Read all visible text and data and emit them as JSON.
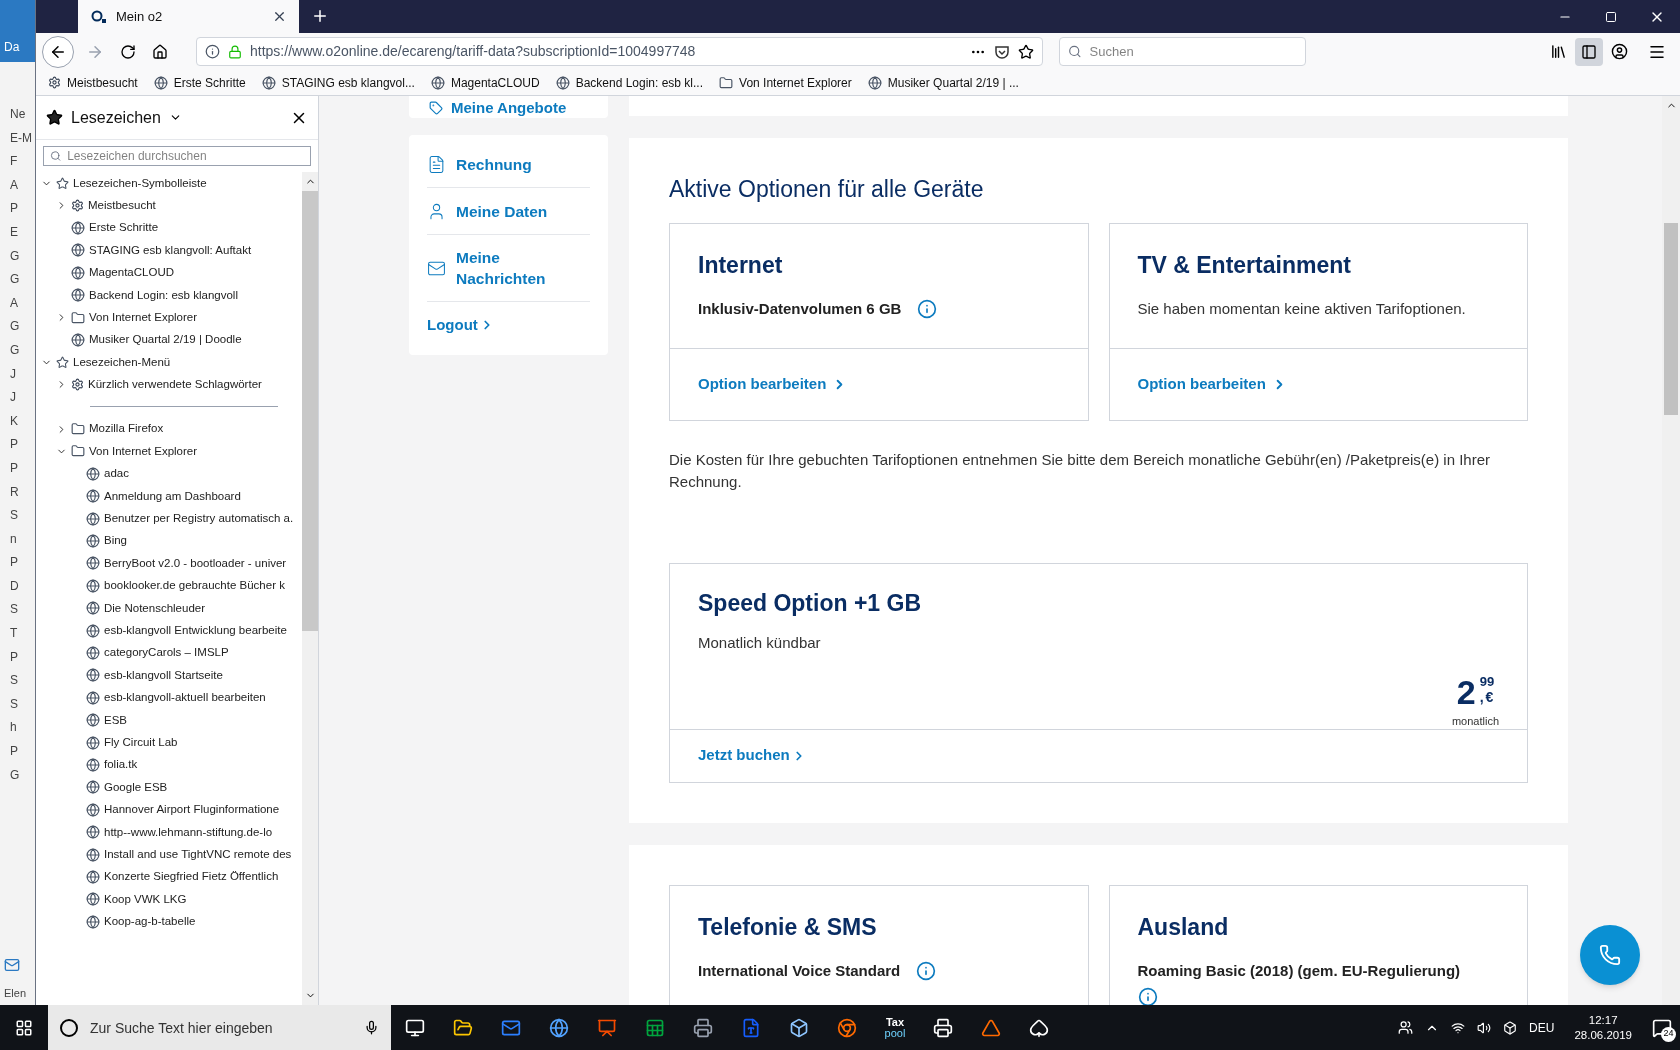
{
  "background_window": {
    "title": "Da",
    "letters": [
      "Ne",
      "E-M",
      "F",
      "A",
      "P",
      "E",
      "G",
      "G",
      "A",
      "G",
      "G",
      "J",
      "J",
      "K",
      "P",
      "P",
      "R",
      "S",
      "n",
      "P",
      "D",
      "S",
      "T",
      "P",
      "S",
      "S",
      "h",
      "P",
      "G"
    ],
    "footer": "Elen"
  },
  "browser": {
    "tab_title": "Mein o2",
    "url": "https://www.o2online.de/ecareng/tariff-data?subscriptionId=1004997748",
    "search_placeholder": "Suchen",
    "bookmarks_toolbar": [
      {
        "label": "Meistbesucht",
        "kind": "query"
      },
      {
        "label": "Erste Schritte",
        "kind": "bookmark"
      },
      {
        "label": "STAGING esb klangvol...",
        "kind": "bookmark"
      },
      {
        "label": "MagentaCLOUD",
        "kind": "bookmark"
      },
      {
        "label": "Backend Login: esb kl...",
        "kind": "bookmark"
      },
      {
        "label": "Von Internet Explorer",
        "kind": "folder"
      },
      {
        "label": "Musiker Quartal 2/19 | ...",
        "kind": "bookmark"
      }
    ]
  },
  "sidebar": {
    "title": "Lesezeichen",
    "search_placeholder": "Lesezeichen durchsuchen",
    "tree": [
      {
        "label": "Lesezeichen-Symbolleiste",
        "kind": "root",
        "expanded": true,
        "children": [
          {
            "label": "Meistbesucht",
            "kind": "query",
            "expanded": false
          },
          {
            "label": "Erste Schritte",
            "kind": "bookmark"
          },
          {
            "label": "STAGING esb klangvoll: Auftakt",
            "kind": "bookmark"
          },
          {
            "label": "MagentaCLOUD",
            "kind": "bookmark"
          },
          {
            "label": "Backend Login: esb klangvoll",
            "kind": "bookmark"
          },
          {
            "label": "Von Internet Explorer",
            "kind": "folder",
            "expanded": false
          },
          {
            "label": "Musiker Quartal 2/19 | Doodle",
            "kind": "bookmark"
          }
        ]
      },
      {
        "label": "Lesezeichen-Menü",
        "kind": "root",
        "expanded": true,
        "children": [
          {
            "label": "Kürzlich verwendete Schlagwörter",
            "kind": "query",
            "expanded": false
          },
          {
            "kind": "separator"
          },
          {
            "label": "Mozilla Firefox",
            "kind": "folder",
            "expanded": false
          },
          {
            "label": "Von Internet Explorer",
            "kind": "folder",
            "expanded": true,
            "children": [
              {
                "label": "adac",
                "kind": "bookmark"
              },
              {
                "label": "Anmeldung am Dashboard",
                "kind": "bookmark"
              },
              {
                "label": "Benutzer per Registry automatisch a.",
                "kind": "bookmark"
              },
              {
                "label": "Bing",
                "kind": "bookmark"
              },
              {
                "label": "BerryBoot v2.0 - bootloader - univer",
                "kind": "bookmark"
              },
              {
                "label": "booklooker.de gebrauchte Bücher k",
                "kind": "bookmark"
              },
              {
                "label": "Die Notenschleuder",
                "kind": "bookmark"
              },
              {
                "label": "esb-klangvoll Entwicklung bearbeite",
                "kind": "bookmark"
              },
              {
                "label": "categoryCarols – IMSLP",
                "kind": "bookmark"
              },
              {
                "label": "esb-klangvoll Startseite",
                "kind": "bookmark"
              },
              {
                "label": "esb-klangvoll-aktuell bearbeiten",
                "kind": "bookmark"
              },
              {
                "label": "ESB",
                "kind": "bookmark"
              },
              {
                "label": "Fly Circuit Lab",
                "kind": "bookmark"
              },
              {
                "label": "folia.tk",
                "kind": "bookmark"
              },
              {
                "label": "Google ESB",
                "kind": "bookmark"
              },
              {
                "label": "Hannover Airport Fluginformatione",
                "kind": "bookmark"
              },
              {
                "label": "http--www.lehmann-stiftung.de-lo",
                "kind": "bookmark"
              },
              {
                "label": "Install and use TightVNC remote des",
                "kind": "bookmark"
              },
              {
                "label": "Konzerte Siegfried Fietz Öffentlich",
                "kind": "bookmark"
              },
              {
                "label": "Koop VWK LKG",
                "kind": "bookmark"
              },
              {
                "label": "Koop-ag-b-tabelle",
                "kind": "bookmark"
              }
            ]
          }
        ]
      }
    ]
  },
  "page": {
    "nav_top": "Meine Angebote",
    "nav": [
      "Rechnung",
      "Meine Daten",
      "Meine Nachrichten"
    ],
    "logout": "Logout",
    "section": {
      "title": "Aktive Optionen für alle Geräte",
      "options": [
        {
          "title": "Internet",
          "detail": "Inklusiv-Datenvolumen 6 GB",
          "kind": "included",
          "link": "Option bearbeiten"
        },
        {
          "title": "TV & Entertainment",
          "detail": "Sie haben momentan keine aktiven Tarifoptionen.",
          "kind": "empty",
          "link": "Option bearbeiten"
        }
      ],
      "note": "Die Kosten für Ihre gebuchten Tarifoptionen entnehmen Sie bitte dem Bereich monatliche Gebühr(en) /Paketpreis(e) in Ihrer Rechnung.",
      "offer": {
        "title": "Speed Option +1 GB",
        "subtitle": "Monatlich kündbar",
        "price_main": "2",
        "price_cents": "99",
        "comma": ",",
        "currency": "€",
        "period": "monatlich",
        "link": "Jetzt buchen"
      }
    },
    "section2": {
      "options": [
        {
          "title": "Telefonie & SMS",
          "detail": "International Voice Standard",
          "kind": "included"
        },
        {
          "title": "Ausland",
          "detail": "Roaming Basic (2018) (gem. EU-Regulierung)",
          "kind": "included-below"
        }
      ]
    }
  },
  "taskbar": {
    "search_placeholder": "Zur Suche Text hier eingeben",
    "tax_label": "Tax",
    "tax_sub": "pool",
    "language": "DEU",
    "time": "12:17",
    "date": "28.06.2019",
    "notifications": "24"
  }
}
